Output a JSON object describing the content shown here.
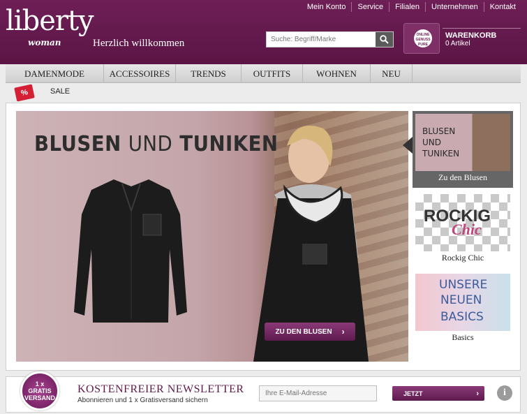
{
  "brand": {
    "logo_main": "liberty",
    "logo_sub": "woman",
    "welcome": "Herzlich willkommen"
  },
  "topnav": [
    "Mein Konto",
    "Service",
    "Filialen",
    "Unternehmen",
    "Kontakt"
  ],
  "search": {
    "placeholder": "Suche: Begriff/Marke",
    "icon": "search-icon"
  },
  "cart": {
    "title": "WARENKORB",
    "count": "0 Artikel",
    "bag_badge": "ONLINE GENUSS PURE"
  },
  "mainnav": [
    "DAMENMODE",
    "ACCESSOIRES",
    "TRENDS",
    "OUTFITS",
    "WOHNEN",
    "NEU"
  ],
  "sale": {
    "tag": "%",
    "label": "SALE"
  },
  "hero": {
    "headline_bold1": "BLUSEN",
    "headline_thin": "UND",
    "headline_bold2": "TUNIKEN",
    "cta": "ZU DEN BLUSEN",
    "cta_arrow": "›"
  },
  "thumbs": [
    {
      "lines": [
        "BLUSEN",
        "UND",
        "TUNIKEN"
      ],
      "caption": "Zu den Blusen"
    },
    {
      "lines": [
        "ROCKIG",
        "Chic"
      ],
      "caption": "Rockig Chic"
    },
    {
      "lines": [
        "UNSERE",
        "NEUEN",
        "BASICS"
      ],
      "caption": "Basics"
    }
  ],
  "newsletter": {
    "badge": [
      "1 x",
      "GRATIS",
      "VERSAND"
    ],
    "title": "KOSTENFREIER NEWSLETTER",
    "subtitle": "Abonnieren und 1 x Gratisversand sichern",
    "email_placeholder": "Ihre E-Mail-Adresse",
    "button": "JETZT",
    "button_arrow": "›",
    "info": "i"
  },
  "colors": {
    "brand": "#6e1f56",
    "sale_red": "#d51f35"
  }
}
